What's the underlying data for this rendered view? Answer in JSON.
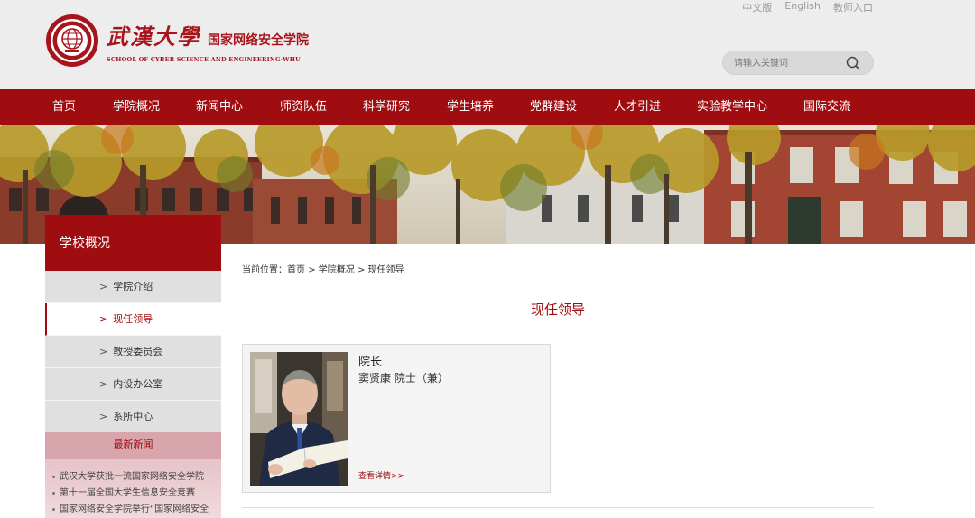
{
  "header": {
    "logo_calligraphy": "武漢大學",
    "school_name_cn": "国家网络安全学院",
    "school_name_en": "SCHOOL OF CYBER SCIENCE AND ENGINEERING·WHU",
    "top_links": [
      "中文版",
      "English",
      "教师入口"
    ],
    "search_placeholder": "请输入关键词"
  },
  "nav": [
    "首页",
    "学院概况",
    "新闻中心",
    "师资队伍",
    "科学研究",
    "学生培养",
    "党群建设",
    "人才引进",
    "实验教学中心",
    "国际交流"
  ],
  "sidebar": {
    "title": "学校概况",
    "items": [
      {
        "label": "学院介绍",
        "active": false
      },
      {
        "label": "现任领导",
        "active": true
      },
      {
        "label": "教授委员会",
        "active": false
      },
      {
        "label": "内设办公室",
        "active": false
      },
      {
        "label": "系所中心",
        "active": false
      }
    ],
    "news_title": "最新新闻",
    "news": [
      "武汉大学获批一流国家网络安全学院",
      "第十一届全国大学生信息安全竞赛",
      "国家网络安全学院举行“国家网络安全"
    ]
  },
  "breadcrumb": {
    "prefix": "当前位置：",
    "items": [
      "首页",
      "学院概况",
      "现任领导"
    ],
    "separator": ">"
  },
  "main": {
    "title": "现任领导",
    "card": {
      "role": "院长",
      "name": "窦贤康 院士（兼）",
      "more": "查看详情>>"
    }
  },
  "colors": {
    "brand_red": "#a00d10",
    "header_bg": "#ededed",
    "sidebar_item_bg": "#e0e0e0",
    "news_bg": "#e6c3c8"
  }
}
